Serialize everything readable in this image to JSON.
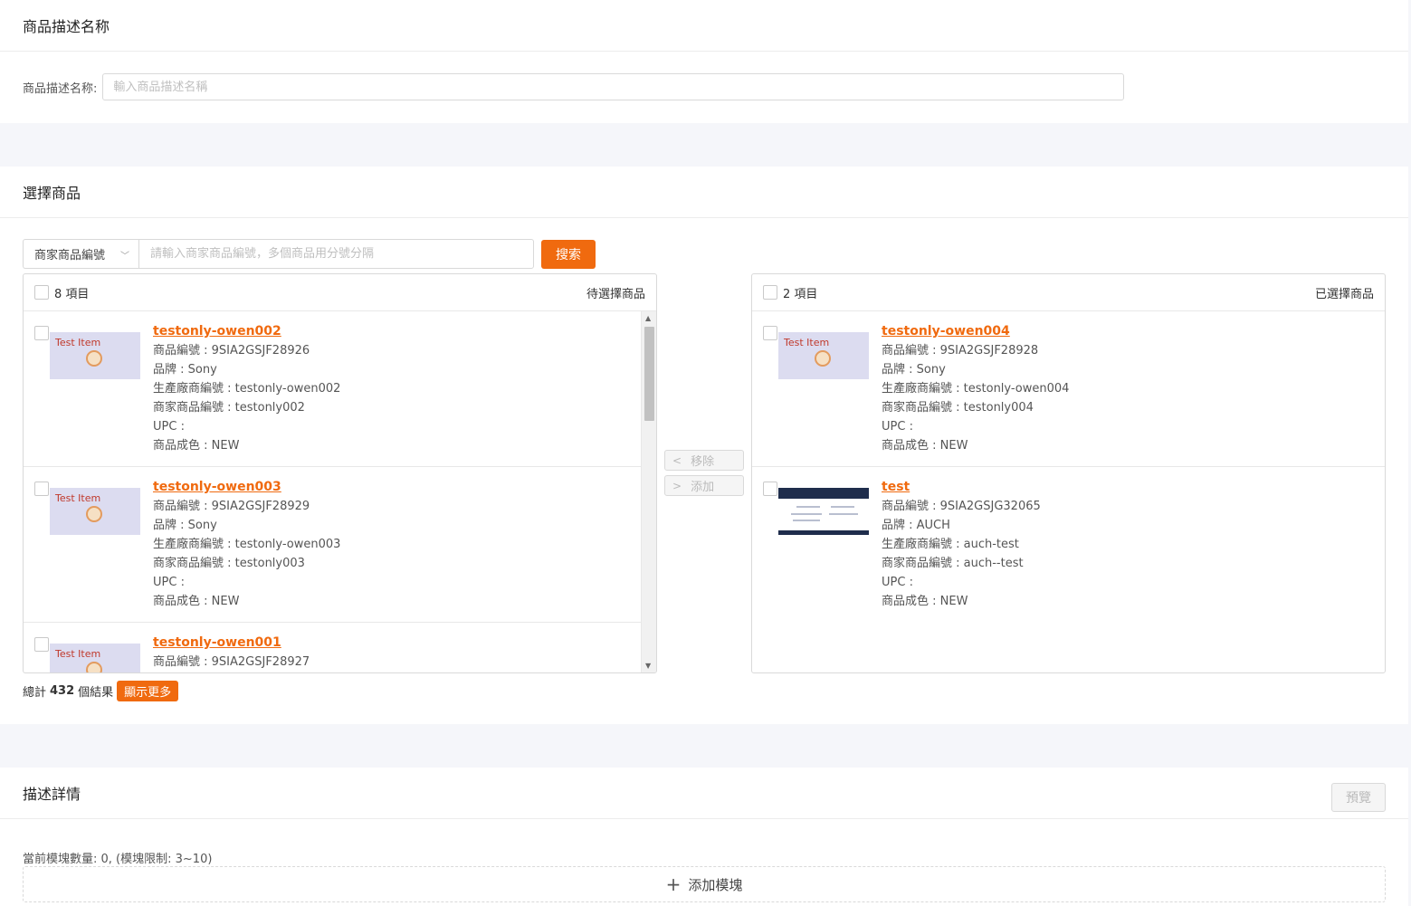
{
  "section1": {
    "title": "商品描述名称",
    "field_label": "商品描述名称:",
    "field_placeholder": "輸入商品描述名稱",
    "field_value": ""
  },
  "section2": {
    "title": "選擇商品",
    "search_type": "商家商品編號",
    "search_placeholder": "請輸入商家商品編號，多個商品用分號分隔",
    "search_button": "搜索",
    "left_panel": {
      "count_label": "8 項目",
      "title": "待選擇商品",
      "items": [
        {
          "name": "testonly-owen002",
          "sku": "商品編號 : 9SIA2GSJF28926",
          "brand": "品牌 : Sony",
          "mfr": "生產廠商編號 : testonly-owen002",
          "seller": "商家商品編號 : testonly002",
          "upc": "UPC :",
          "cond": "商品成色 : NEW",
          "thumb_text": "Test Item"
        },
        {
          "name": "testonly-owen003",
          "sku": "商品編號 : 9SIA2GSJF28929",
          "brand": "品牌 : Sony",
          "mfr": "生產廠商編號 : testonly-owen003",
          "seller": "商家商品編號 : testonly003",
          "upc": "UPC :",
          "cond": "商品成色 : NEW",
          "thumb_text": "Test Item"
        },
        {
          "name": "testonly-owen001",
          "sku": "商品編號 : 9SIA2GSJF28927",
          "thumb_text": "Test Item"
        }
      ]
    },
    "right_panel": {
      "count_label": "2 項目",
      "title": "已選擇商品",
      "items": [
        {
          "name": "testonly-owen004",
          "sku": "商品編號 : 9SIA2GSJF28928",
          "brand": "品牌 : Sony",
          "mfr": "生產廠商編號 : testonly-owen004",
          "seller": "商家商品編號 : testonly004",
          "upc": "UPC :",
          "cond": "商品成色 : NEW",
          "thumb_text": "Test Item"
        },
        {
          "name": "test",
          "sku": "商品編號 : 9SIA2GSJG32065",
          "brand": "品牌 : AUCH",
          "mfr": "生產廠商編號 : auch-test",
          "seller": "商家商品編號 : auch--test",
          "upc": "UPC :",
          "cond": "商品成色 : NEW"
        }
      ]
    },
    "remove_button": "移除",
    "add_button": "添加",
    "total_prefix": "總計",
    "total_count": "432",
    "total_suffix": "個結果",
    "show_more": "顯示更多"
  },
  "section3": {
    "title": "描述詳情",
    "preview_button": "預覽",
    "module_count": "當前模塊數量: 0, (模塊限制: 3~10)",
    "add_module": "添加模塊"
  },
  "colors": {
    "accent": "#f06a0f",
    "background": "#f5f6fa"
  }
}
